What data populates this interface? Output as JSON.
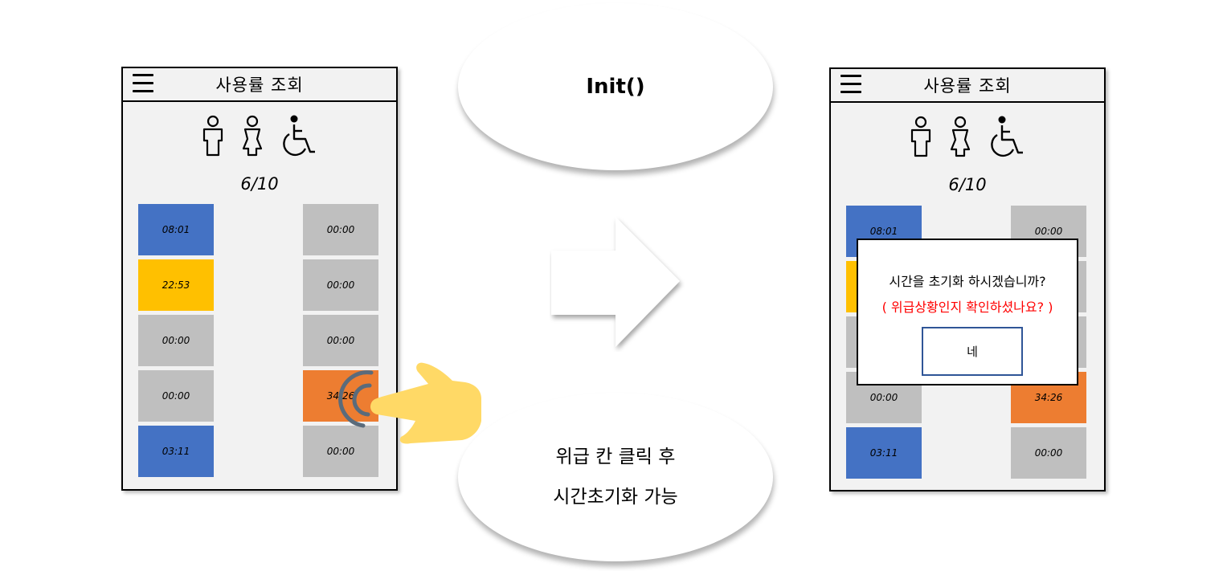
{
  "before_screen": {
    "title": "사용률 조회",
    "date": "6/10",
    "cells": [
      {
        "label": "08:01",
        "color": "blue"
      },
      {
        "label": "22:53",
        "color": "yellow"
      },
      {
        "label": "00:00",
        "color": "gray"
      },
      {
        "label": "00:00",
        "color": "gray"
      },
      {
        "label": "03:11",
        "color": "blue"
      },
      {
        "label": "00:00",
        "color": "gray"
      },
      {
        "label": "00:00",
        "color": "gray"
      },
      {
        "label": "00:00",
        "color": "gray"
      },
      {
        "label": "34:26",
        "color": "orange"
      },
      {
        "label": "00:00",
        "color": "gray"
      }
    ]
  },
  "after_screen": {
    "title": "사용률 조회",
    "date": "6/10",
    "cells": [
      {
        "label": "08:01",
        "color": "blue"
      },
      {
        "label": "",
        "color": "yellow"
      },
      {
        "label": "",
        "color": "gray"
      },
      {
        "label": "00:00",
        "color": "gray"
      },
      {
        "label": "03:11",
        "color": "blue"
      },
      {
        "label": "00:00",
        "color": "gray"
      },
      {
        "label": "",
        "color": "gray"
      },
      {
        "label": "",
        "color": "gray"
      },
      {
        "label": "34:26",
        "color": "orange"
      },
      {
        "label": "00:00",
        "color": "gray"
      }
    ],
    "dialog": {
      "question": "시간을 초기화 하시겠습니까?",
      "warning": "( 위급상황인지 확인하셨나요? )",
      "confirm_label": "네"
    }
  },
  "bubble_top": "Init()",
  "bubble_bottom": "위급 칸 클릭 후\n시간초기화 가능",
  "icons": [
    "man-icon",
    "woman-icon",
    "wheelchair-icon",
    "hamburger-menu-icon",
    "pointing-hand-icon",
    "right-arrow-icon"
  ],
  "colors": {
    "blue": "#4472c4",
    "yellow": "#ffc000",
    "gray": "#bfbfbf",
    "orange": "#ed7d31",
    "warning": "#ff0000",
    "button_border": "#2f5597",
    "hand": "#ffd966",
    "tap": "#5a6b7b"
  }
}
